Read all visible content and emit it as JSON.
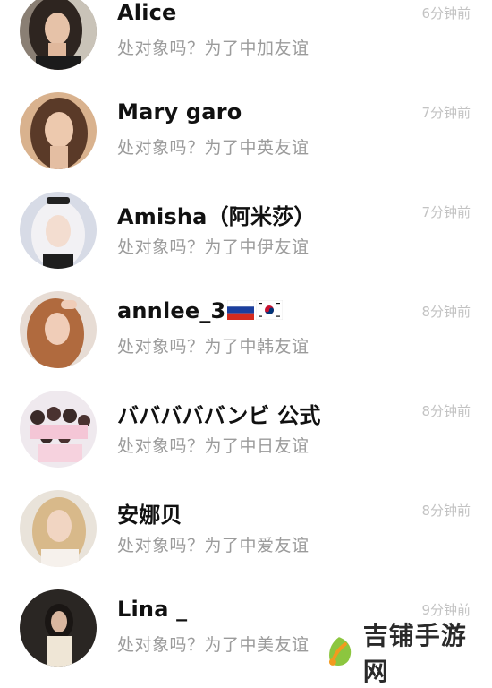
{
  "contacts": [
    {
      "name": "Alice",
      "message": "处对象吗？为了中加友谊",
      "time": "6分钟前",
      "avatar": "avatar-photo-woman-dark-hair"
    },
    {
      "name": "Mary garo",
      "message": "处对象吗？为了中英友谊",
      "time": "7分钟前",
      "avatar": "avatar-photo-woman-brown-hair"
    },
    {
      "name": "Amisha（阿米莎）",
      "message": "处对象吗？为了中伊友谊",
      "time": "7分钟前",
      "avatar": "avatar-photo-woman-platinum-hair"
    },
    {
      "name": "annlee_3",
      "message": "处对象吗？为了中韩友谊",
      "time": "8分钟前",
      "avatar": "avatar-photo-woman-auburn-hair",
      "flags": [
        "russia-flag",
        "south-korea-flag"
      ]
    },
    {
      "name": "バババババンビ 公式",
      "message": "处对象吗？为了中日友谊",
      "time": "8分钟前",
      "avatar": "avatar-photo-group"
    },
    {
      "name": "安娜贝",
      "message": "处对象吗？为了中爱友谊",
      "time": "8分钟前",
      "avatar": "avatar-photo-woman-blonde-hair"
    },
    {
      "name": "Lina _",
      "message": "处对象吗？为了中美友谊",
      "time": "9分钟前",
      "avatar": "avatar-photo-woman-mirror-selfie"
    }
  ],
  "watermark": {
    "text": "吉铺手游网",
    "icon": "leaf-logo-icon",
    "colors": {
      "green": "#8cc63f",
      "orange": "#f39a1e"
    }
  }
}
